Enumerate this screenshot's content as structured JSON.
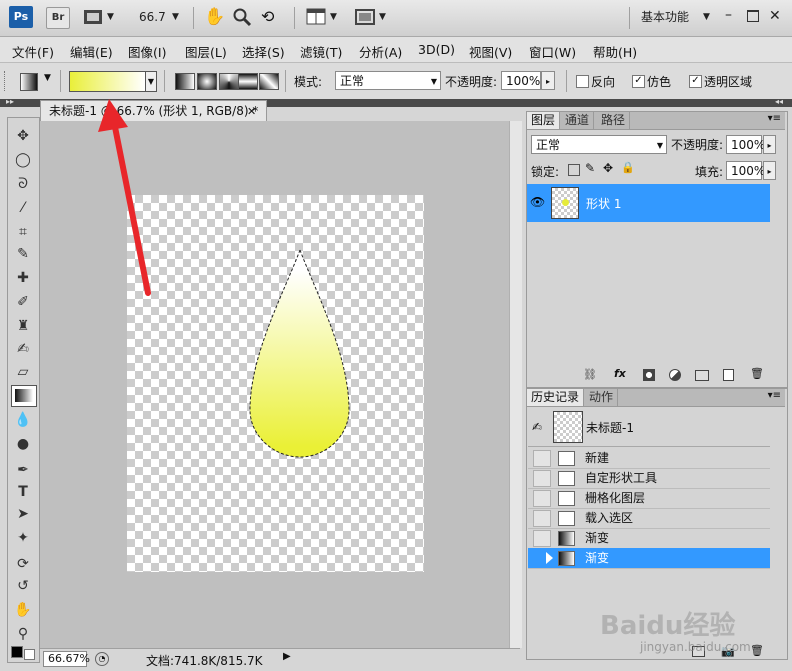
{
  "app": {
    "logo": "Ps",
    "bridge": "Br",
    "zoom": "66.7",
    "workspace": "基本功能"
  },
  "menu": [
    "文件(F)",
    "编辑(E)",
    "图像(I)",
    "图层(L)",
    "选择(S)",
    "滤镜(T)",
    "分析(A)",
    "3D(D)",
    "视图(V)",
    "窗口(W)",
    "帮助(H)"
  ],
  "options": {
    "gradient_from": "#e9ef3a",
    "gradient_to": "#ffffff",
    "mode_label": "模式:",
    "mode_value": "正常",
    "opacity_label": "不透明度:",
    "opacity_value": "100%",
    "reverse_label": "反向",
    "reverse_checked": false,
    "dither_label": "仿色",
    "dither_checked": true,
    "transparency_label": "透明区域",
    "transparency_checked": true
  },
  "document": {
    "tab_title": "未标题-1 @ 66.7% (形状 1, RGB/8) *",
    "zoom_status": "66.67%",
    "doc_info": "文档:741.8K/815.7K",
    "drop_color_top": "#ffffff",
    "drop_color_bottom": "#eaf036"
  },
  "layers_panel": {
    "tabs": [
      "图层",
      "通道",
      "路径"
    ],
    "blend_mode": "正常",
    "opacity_label": "不透明度:",
    "opacity_value": "100%",
    "lock_label": "锁定:",
    "fill_label": "填充:",
    "fill_value": "100%",
    "layer_name": "形状 1",
    "selected_color": "#3399ff"
  },
  "history_panel": {
    "tabs": [
      "历史记录",
      "动作"
    ],
    "snapshot": "未标题-1",
    "items": [
      "新建",
      "自定形状工具",
      "栅格化图层",
      "载入选区",
      "渐变",
      "渐变"
    ],
    "selected_index": 5
  },
  "watermark": {
    "brand": "Baidu经验",
    "url": "jingyan.baidu.com"
  }
}
